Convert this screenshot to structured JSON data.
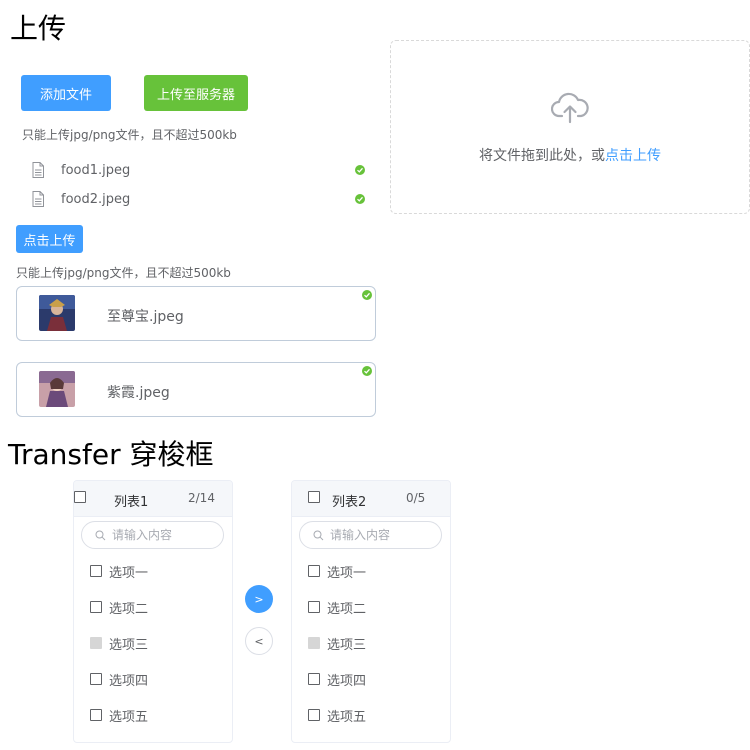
{
  "upload_section": {
    "title": "上传",
    "add_file_button": "添加文件",
    "upload_server_button": "上传至服务器",
    "tip": "只能上传jpg/png文件，且不超过500kb",
    "files": [
      {
        "name": "food1.jpeg",
        "icon": "document-icon",
        "status": "success"
      },
      {
        "name": "food2.jpeg",
        "icon": "document-icon",
        "status": "success"
      }
    ],
    "click_upload_button": "点击上传",
    "tip2": "只能上传jpg/png文件，且不超过500kb",
    "picture_files": [
      {
        "name": "至尊宝.jpeg",
        "status": "success"
      },
      {
        "name": "紫霞.jpeg",
        "status": "success"
      }
    ],
    "dropzone": {
      "icon": "upload-cloud-icon",
      "text": "将文件拖到此处，或",
      "link": "点击上传"
    }
  },
  "transfer_section": {
    "title": "Transfer 穿梭框",
    "left_panel": {
      "title": "列表1",
      "count": "2/14",
      "placeholder": "请输入内容",
      "items": [
        {
          "label": "选项一",
          "disabled": false
        },
        {
          "label": "选项二",
          "disabled": false
        },
        {
          "label": "选项三",
          "disabled": true
        },
        {
          "label": "选项四",
          "disabled": false
        },
        {
          "label": "选项五",
          "disabled": false
        }
      ]
    },
    "right_panel": {
      "title": "列表2",
      "count": "0/5",
      "placeholder": "请输入内容",
      "items": [
        {
          "label": "选项一",
          "disabled": false
        },
        {
          "label": "选项二",
          "disabled": false
        },
        {
          "label": "选项三",
          "disabled": true
        },
        {
          "label": "选项四",
          "disabled": false
        },
        {
          "label": "选项五",
          "disabled": false
        }
      ]
    },
    "to_right_button": ">",
    "to_left_button": "<"
  },
  "colors": {
    "primary": "#409eff",
    "success": "#67c23a",
    "text": "#606266",
    "border": "#dcdfe6"
  }
}
